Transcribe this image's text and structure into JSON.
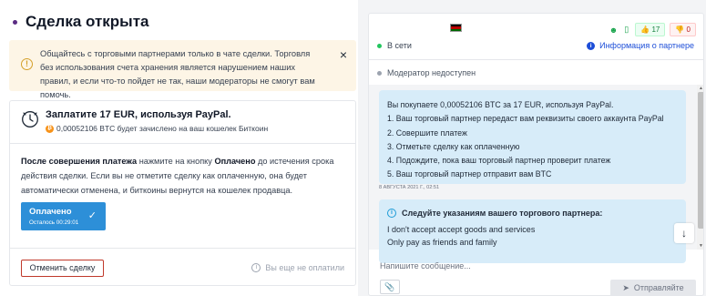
{
  "page": {
    "title": "Сделка открыта"
  },
  "warning": {
    "text": "Общайтесь с торговыми партнерами только в чате сделки. Торговля без использования счета хранения является нарушением наших правил, и если что-то пойдет не так, наши модераторы не смогут вам помочь.",
    "close": "×"
  },
  "payment": {
    "title": "Заплатите 17 EUR, используя PayPal.",
    "subtitle": "0,00052106 BTC будет зачислено на ваш кошелек Биткоин",
    "btc_glyph": "₿",
    "instructions_bold": "После совершения платежа",
    "instructions_part1": " нажмите на кнопку ",
    "instructions_bold2": "Оплачено",
    "instructions_part2": " до истечения срока действия сделки. Если вы не отметите сделку как оплаченную, она будет автоматически отменена, и биткоины вернутся на кошелек продавца.",
    "paid_button": "Оплачено",
    "time_left": "Осталось 00:29:01",
    "cancel_button": "Отменить сделку",
    "not_paid_status": "Вы еще не оплатили"
  },
  "partner": {
    "status": "В сети",
    "info_link": "Информация о партнере",
    "likes": "17",
    "dislikes": "0",
    "moderator": "Модератор недоступен"
  },
  "chat": {
    "message1": {
      "lines": [
        "Вы покупаете 0,00052106 BTC за 17 EUR, используя PayPal.",
        "1. Ваш торговый партнер передаст вам реквизиты своего аккаунта PayPal",
        "2. Совершите платеж",
        "3. Отметьте сделку как оплаченную",
        "4. Подождите, пока ваш торговый партнер проверит платеж",
        "5. Ваш торговый партнер отправит вам BTC"
      ],
      "timestamp": "8 АВГУСТА 2021 Г., 02:51"
    },
    "message2": {
      "title": "Следуйте указаниям вашего торгового партнера:",
      "lines": [
        "I don't accept accept goods and services",
        "Only pay as friends and family"
      ]
    },
    "input_placeholder": "Напишите сообщение...",
    "send_button": "Отправляйте"
  },
  "icons": {
    "title_dot_color": "#5b2c83",
    "accent_blue": "#2d8fd8",
    "online_green": "#22c55e",
    "cancel_border": "#c0392b",
    "warning_bg": "#fdf5e6"
  }
}
